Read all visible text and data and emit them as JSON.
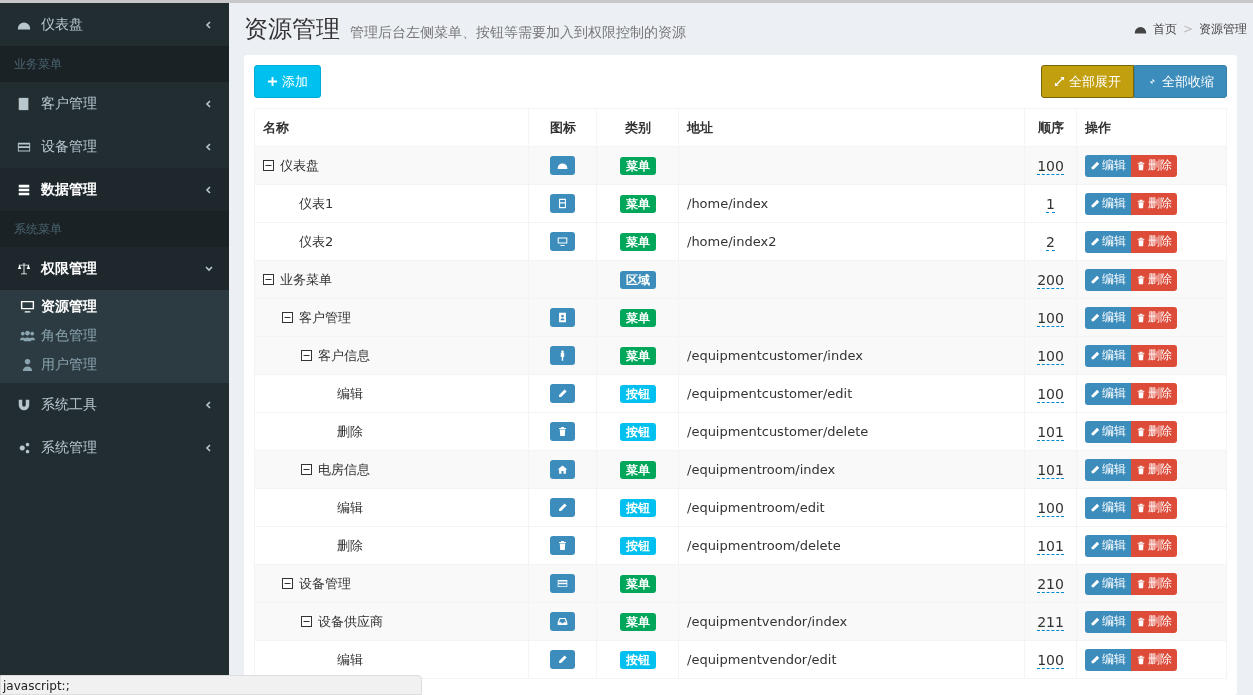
{
  "sidebar": {
    "items": [
      {
        "kind": "item",
        "label": "仪表盘",
        "active": false,
        "expanded": false
      },
      {
        "kind": "header",
        "label": "业务菜单"
      },
      {
        "kind": "item",
        "label": "客户管理",
        "active": false,
        "expanded": false
      },
      {
        "kind": "item",
        "label": "设备管理",
        "active": false,
        "expanded": false
      },
      {
        "kind": "item",
        "label": "数据管理",
        "active": true,
        "expanded": false
      },
      {
        "kind": "header",
        "label": "系统菜单"
      },
      {
        "kind": "item",
        "label": "权限管理",
        "active": true,
        "expanded": true,
        "children": [
          {
            "label": "资源管理",
            "selected": true
          },
          {
            "label": "角色管理",
            "selected": false
          },
          {
            "label": "用户管理",
            "selected": false
          }
        ]
      },
      {
        "kind": "item",
        "label": "系统工具",
        "active": false,
        "expanded": false
      },
      {
        "kind": "item",
        "label": "系统管理",
        "active": false,
        "expanded": false
      }
    ]
  },
  "page": {
    "title": "资源管理",
    "subtitle": "管理后台左侧菜单、按钮等需要加入到权限控制的资源"
  },
  "breadcrumb": {
    "items": [
      "首页",
      "资源管理"
    ],
    "separator": ">"
  },
  "toolbar": {
    "add": "添加",
    "expand_all": "全部展开",
    "collapse_all": "全部收缩"
  },
  "table": {
    "columns": [
      "名称",
      "图标",
      "类别",
      "地址",
      "顺序",
      "操作"
    ],
    "rows": [
      {
        "name": "仪表盘",
        "kind": "menu",
        "type_label": "菜单",
        "order": "100",
        "edit": "编辑",
        "delete": "删除",
        "expanded": true,
        "children": [
          {
            "name": "仪表1",
            "kind": "menu",
            "type_label": "菜单",
            "address": "/home/index",
            "order": "1",
            "edit": "编辑",
            "delete": "删除"
          },
          {
            "name": "仪表2",
            "kind": "menu",
            "type_label": "菜单",
            "address": "/home/index2",
            "order": "2",
            "edit": "编辑",
            "delete": "删除"
          }
        ]
      },
      {
        "name": "业务菜单",
        "kind": "area",
        "type_label": "区域",
        "order": "200",
        "edit": "编辑",
        "delete": "删除",
        "expanded": true,
        "children": [
          {
            "name": "客户管理",
            "kind": "menu",
            "type_label": "菜单",
            "order": "100",
            "edit": "编辑",
            "delete": "删除",
            "expanded": true,
            "children": [
              {
                "name": "客户信息",
                "kind": "menu",
                "type_label": "菜单",
                "address": "/equipmentcustomer/index",
                "order": "100",
                "edit": "编辑",
                "delete": "删除",
                "expanded": true,
                "children": [
                  {
                    "name": "编辑",
                    "kind": "button",
                    "type_label": "按钮",
                    "address": "/equipmentcustomer/edit",
                    "order": "100",
                    "edit": "编辑",
                    "delete": "删除"
                  },
                  {
                    "name": "删除",
                    "kind": "button",
                    "type_label": "按钮",
                    "address": "/equipmentcustomer/delete",
                    "order": "101",
                    "edit": "编辑",
                    "delete": "删除"
                  }
                ]
              },
              {
                "name": "电房信息",
                "kind": "menu",
                "type_label": "菜单",
                "address": "/equipmentroom/index",
                "order": "101",
                "edit": "编辑",
                "delete": "删除",
                "expanded": true,
                "children": [
                  {
                    "name": "编辑",
                    "kind": "button",
                    "type_label": "按钮",
                    "address": "/equipmentroom/edit",
                    "order": "100",
                    "edit": "编辑",
                    "delete": "删除"
                  },
                  {
                    "name": "删除",
                    "kind": "button",
                    "type_label": "按钮",
                    "address": "/equipmentroom/delete",
                    "order": "101",
                    "edit": "编辑",
                    "delete": "删除"
                  }
                ]
              }
            ]
          },
          {
            "name": "设备管理",
            "kind": "menu",
            "type_label": "菜单",
            "order": "210",
            "edit": "编辑",
            "delete": "删除",
            "expanded": true,
            "children": [
              {
                "name": "设备供应商",
                "kind": "menu",
                "type_label": "菜单",
                "address": "/equipmentvendor/index",
                "order": "211",
                "edit": "编辑",
                "delete": "删除",
                "expanded": true,
                "children": [
                  {
                    "name": "编辑",
                    "kind": "button",
                    "type_label": "按钮",
                    "address": "/equipmentvendor/edit",
                    "order": "100",
                    "edit": "编辑",
                    "delete": "删除"
                  }
                ]
              }
            ]
          }
        ]
      }
    ]
  },
  "status_bar": "javascript:;"
}
